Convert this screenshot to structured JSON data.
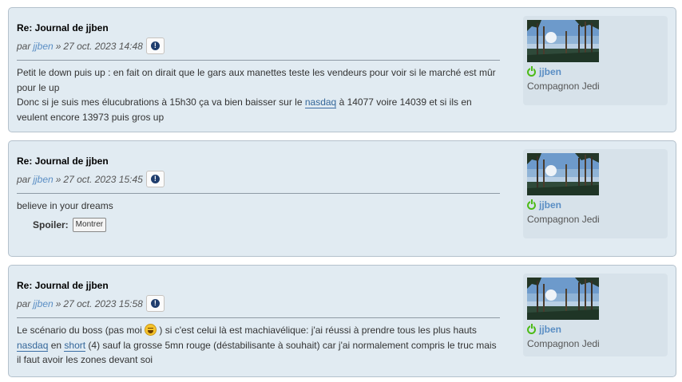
{
  "posts": [
    {
      "title": "Re: Journal de jjben",
      "by": "par",
      "author": "jjben",
      "sep": "»",
      "date": "27 oct. 2023 14:48",
      "report_icon": "!",
      "lines": {
        "l1": "Petit le down puis up : en fait on dirait que le gars aux manettes teste les vendeurs pour voir si le marché est mûr pour le up",
        "l2_before": "Donc si je suis mes élucubrations à 15h30 ça va bien baisser sur le ",
        "l2_link": "nasdaq",
        "l2_after": " à 14077 voire 14039 et si ils en veulent encore 13973 puis gros up"
      },
      "profile": {
        "username": "jjben",
        "rank": "Compagnon Jedi",
        "status_icon": "online-icon"
      }
    },
    {
      "title": "Re: Journal de jjben",
      "by": "par",
      "author": "jjben",
      "sep": "»",
      "date": "27 oct. 2023 15:45",
      "report_icon": "!",
      "lines": {
        "l1": "believe in your dreams"
      },
      "spoiler": {
        "label": "Spoiler:",
        "button": "Montrer"
      },
      "profile": {
        "username": "jjben",
        "rank": "Compagnon Jedi",
        "status_icon": "online-icon"
      }
    },
    {
      "title": "Re: Journal de jjben",
      "by": "par",
      "author": "jjben",
      "sep": "»",
      "date": "27 oct. 2023 15:58",
      "report_icon": "!",
      "lines": {
        "l1_before": "Le scénario du boss (pas moi ",
        "l1_after": " ) si c'est celui là est machiavélique: j'ai réussi à prendre tous les plus hauts ",
        "l1_link1": "nasdaq",
        "l1_mid": " en ",
        "l1_link2": "short",
        "l1_end": " (4) sauf la grosse 5mn rouge (déstabilisante à souhait) car j'ai normalement compris le truc mais il faut avoir les zones devant soi"
      },
      "profile": {
        "username": "jjben",
        "rank": "Compagnon Jedi",
        "status_icon": "online-icon"
      }
    }
  ]
}
